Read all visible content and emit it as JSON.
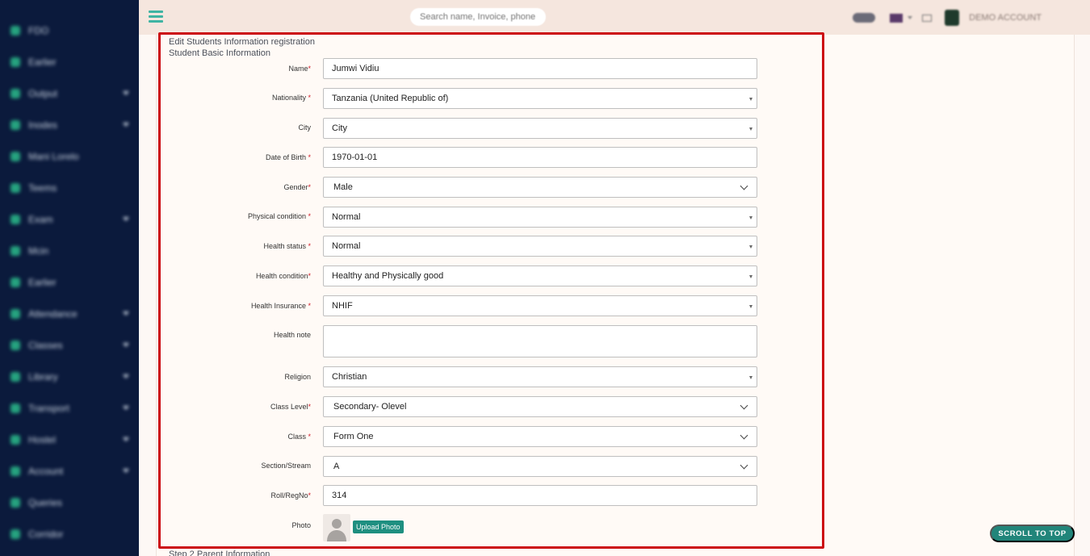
{
  "colors": {
    "sidebar": "#0b1a3c",
    "accent": "#1e8f80",
    "highlight": "#cc0b12",
    "topbar": "#f5e6de"
  },
  "topbar": {
    "search_placeholder": "Search name, Invoice, phone, r",
    "account": "DEMO ACCOUNT"
  },
  "sidebar": {
    "items": [
      {
        "label": "FDO",
        "icon": "home-icon",
        "chevron": false
      },
      {
        "label": "Earlier",
        "icon": "circle-icon",
        "chevron": false
      },
      {
        "label": "Output",
        "icon": "edit-icon",
        "chevron": true
      },
      {
        "label": "Inodes",
        "icon": "edit-icon",
        "chevron": true
      },
      {
        "label": "Mani Lorelo",
        "icon": "user-icon",
        "chevron": false
      },
      {
        "label": "Teems",
        "icon": "chart-icon",
        "chevron": false
      },
      {
        "label": "Exam",
        "icon": "book-icon",
        "chevron": true
      },
      {
        "label": "Mcin",
        "icon": "user-icon",
        "chevron": false
      },
      {
        "label": "Earlier",
        "icon": "circle-icon",
        "chevron": false
      },
      {
        "label": "Attendance",
        "icon": "check-icon",
        "chevron": true
      },
      {
        "label": "Classes",
        "icon": "edit-icon",
        "chevron": true
      },
      {
        "label": "Library",
        "icon": "book-icon",
        "chevron": true
      },
      {
        "label": "Transport",
        "icon": "bus-icon",
        "chevron": true
      },
      {
        "label": "Hostel",
        "icon": "home-icon",
        "chevron": true
      },
      {
        "label": "Account",
        "icon": "money-icon",
        "chevron": true
      },
      {
        "label": "Queries",
        "icon": "chat-icon",
        "chevron": false
      },
      {
        "label": "Corridor",
        "icon": "user-icon",
        "chevron": false
      },
      {
        "label": "",
        "icon": "user-icon",
        "chevron": false
      }
    ]
  },
  "form": {
    "page_title": "Edit Students Information registration",
    "section_title": "Student Basic Information",
    "next_section": "Step 2 Parent Information",
    "fields": {
      "name": {
        "label": "Name",
        "value": "Jumwi Vidiu"
      },
      "nationality": {
        "label": "Nationality ",
        "value": "Tanzania (United Republic of)"
      },
      "city": {
        "label": "City",
        "value": "City"
      },
      "dob": {
        "label": "Date of Birth ",
        "value": "1970-01-01"
      },
      "gender": {
        "label": "Gender",
        "value": "Male"
      },
      "physical": {
        "label": "Physical condition ",
        "value": "Normal"
      },
      "health_status": {
        "label": "Health status ",
        "value": "Normal"
      },
      "health_condition": {
        "label": "Health condition",
        "value": "Healthy and Physically good"
      },
      "insurance": {
        "label": "Health Insurance ",
        "value": "NHIF"
      },
      "health_note": {
        "label": "Health note",
        "value": ""
      },
      "religion": {
        "label": "Religion",
        "value": "Christian"
      },
      "class_level": {
        "label": "Class Level",
        "value": "Secondary- Olevel"
      },
      "class": {
        "label": "Class ",
        "value": "Form One"
      },
      "section": {
        "label": "Section/Stream",
        "value": "A"
      },
      "roll": {
        "label": "Roll/RegNo",
        "value": "314"
      },
      "photo": {
        "label": "Photo",
        "button": "Upload Photo"
      }
    },
    "required_mark": "*"
  },
  "scroll_top": "SCROLL TO TOP"
}
